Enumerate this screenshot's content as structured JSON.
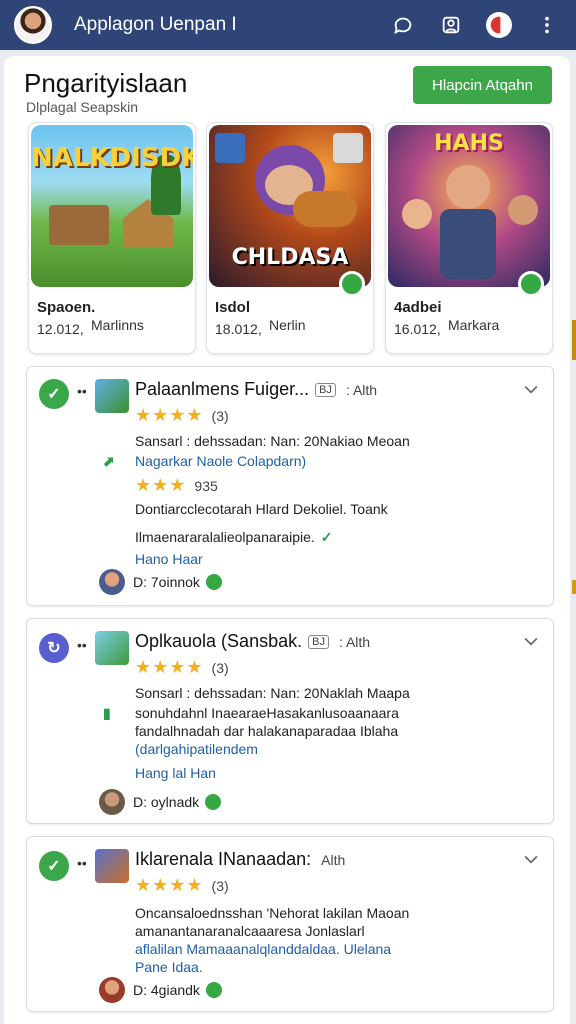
{
  "header": {
    "app_title": "Applagon Uenpan I"
  },
  "section": {
    "title": "Pngarityislaan",
    "subtitle": "Dlplagal Seapskin",
    "action_label": "Hlapcin Atqahn"
  },
  "featured": [
    {
      "art_title": "NALKDISDK",
      "name": "Spaoen.",
      "meta_left": "12.012,",
      "meta_right": "Marlinns"
    },
    {
      "art_title": "CHLDASA",
      "name": "Isdol",
      "meta_left": "18.012,",
      "meta_right": "Nerlin"
    },
    {
      "art_title": "HAHS",
      "name": "4adbei",
      "meta_left": "16.012,",
      "meta_right": "Markara"
    }
  ],
  "items": [
    {
      "title": "Palaanlmens Fuiger...",
      "chip": "BJ",
      "tag": ": Alth",
      "stars": "★★★★",
      "rating_count": "(3)",
      "line1": "Sansarl : dehssadan: Nan: 20Nakiao Meoan",
      "line2": "Nagarkar Naole Colapdarn)",
      "stars2": "★★★",
      "rating_count2": "935",
      "line3": "Dontiarcclecotarah Hlard Dekoliel. Toank",
      "line4": "Ilmaenararalalieolpanaraipie.",
      "line5": "Hano Haar",
      "footer_name": "D: 7oinnok"
    },
    {
      "title": "Oplkauola (Sansbak.",
      "chip": "BJ",
      "tag": ": Alth",
      "stars": "★★★★",
      "rating_count": "(3)",
      "line1": "Sonsarl : dehssadan: Nan: 20Naklah Maapa",
      "line2": "sonuhdahnl InaearaeHasakanlusoaanaara",
      "line3": "fandalhnadah dar halakanaparadaa Iblaha",
      "line4": "(darlgahipatilendem",
      "line5": "Hang lal Han",
      "footer_name": "D: oylnadk"
    },
    {
      "title": "Iklarenala INanaadan:",
      "chip": "",
      "tag": "Alth",
      "stars": "★★★★",
      "rating_count": "(3)",
      "line1": "Oncansaloednsshan 'Nehorat lakilan Maoan",
      "line2": "amanantanaranalcaaaresa Jonlaslarl",
      "line3": "aflalilan Mamaaanalqlanddaldaa. Ulelana",
      "line4": "Pane Idaa.",
      "footer_name": "D: 4giandk"
    }
  ]
}
